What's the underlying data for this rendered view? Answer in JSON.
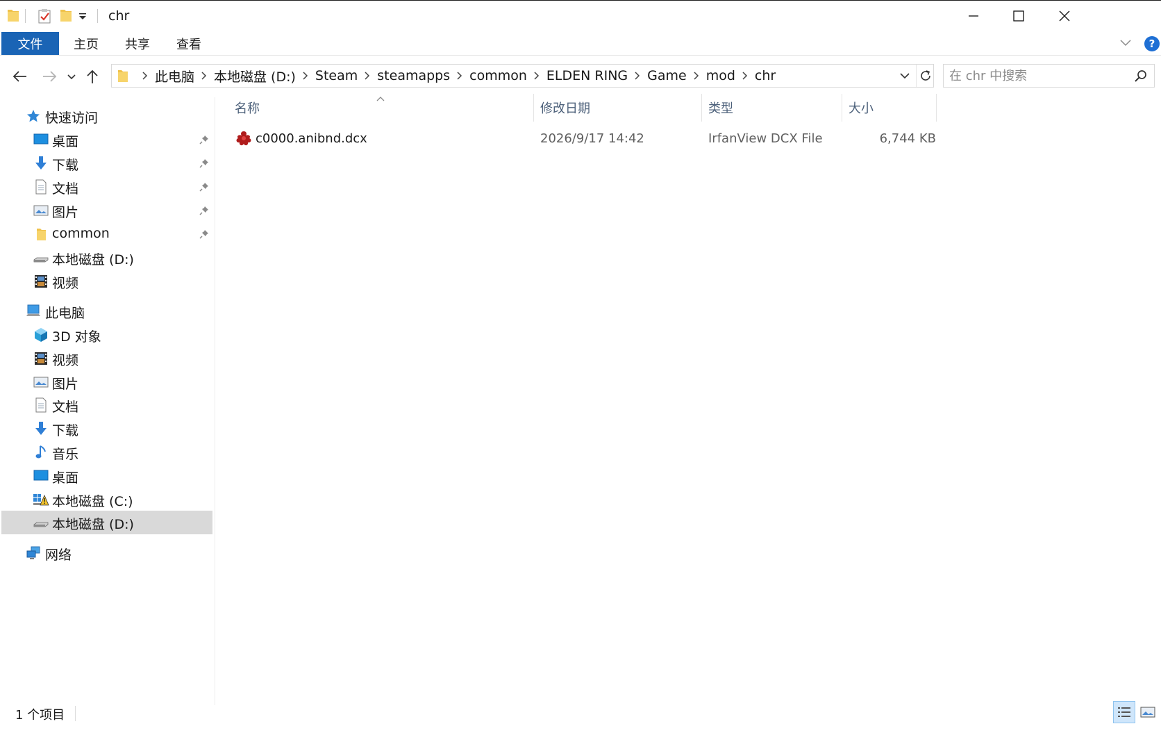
{
  "window": {
    "title": "chr"
  },
  "ribbon": {
    "tabs": [
      "文件",
      "主页",
      "共享",
      "查看"
    ]
  },
  "address": {
    "segments": [
      "此电脑",
      "本地磁盘 (D:)",
      "Steam",
      "steamapps",
      "common",
      "ELDEN RING",
      "Game",
      "mod",
      "chr"
    ]
  },
  "search": {
    "placeholder": "在 chr 中搜索"
  },
  "sidebar": {
    "quick_access": {
      "label": "快速访问",
      "items": [
        "桌面",
        "下载",
        "文档",
        "图片",
        "common",
        "本地磁盘 (D:)",
        "视频"
      ]
    },
    "this_pc": {
      "label": "此电脑",
      "items": [
        "3D 对象",
        "视频",
        "图片",
        "文档",
        "下载",
        "音乐",
        "桌面",
        "本地磁盘 (C:)",
        "本地磁盘 (D:)"
      ],
      "selected_index": 8
    },
    "network": {
      "label": "网络"
    }
  },
  "columns": {
    "name": "名称",
    "modified": "修改日期",
    "type": "类型",
    "size": "大小"
  },
  "files": [
    {
      "name": "c0000.anibnd.dcx",
      "modified": "2026/9/17 14:42",
      "type": "IrfanView DCX File",
      "size": "6,744 KB",
      "icon": "irfanview-file-icon"
    }
  ],
  "status": {
    "count": "1 个项目"
  },
  "colors": {
    "accent": "#1a64b5",
    "selection": "#d9d9d9",
    "folder": "#f0c24b",
    "header_text": "#4c607a"
  }
}
